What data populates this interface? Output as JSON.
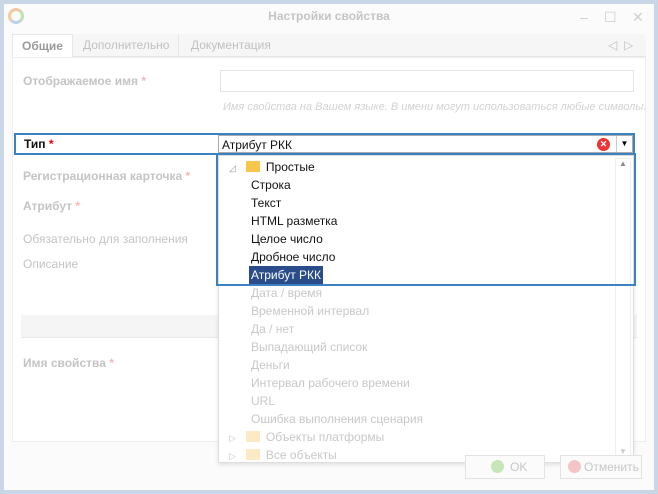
{
  "window": {
    "title": "Настройки свойства",
    "minimize": "–",
    "maximize": "☐",
    "close": "✕"
  },
  "tabs": [
    {
      "label": "Общие",
      "active": true
    },
    {
      "label": "Дополнительно"
    },
    {
      "label": "Документация"
    }
  ],
  "tab_nav": {
    "prev": "◁",
    "next": "▷"
  },
  "form": {
    "display_name_label": "Отображаемое имя",
    "display_name_value": "",
    "display_name_hint": "Имя свойства на Вашем языке. В имени могут использоваться любые символы.",
    "type_label": "Тип",
    "type_value": "Атрибут РКК",
    "reg_card_label": "Регистрационная карточка",
    "attribute_label": "Атрибут",
    "required_label": "Обязательно для заполнения",
    "description_label": "Описание",
    "property_name_label": "Имя свойства",
    "required_mark": "*"
  },
  "dropdown": {
    "group": "Простые",
    "group_toggle": "◿",
    "items": [
      "Строка",
      "Текст",
      "HTML разметка",
      "Целое число",
      "Дробное число",
      "Атрибут РКК",
      "Дата / время",
      "Временной интервал",
      "Да / нет",
      "Выпадающий список",
      "Деньги",
      "Интервал рабочего времени",
      "URL",
      "Ошибка выполнения сценария"
    ],
    "selected": "Атрибут РКК",
    "folders": [
      "Объекты платформы",
      "Все объекты"
    ],
    "folder_toggle": "▷"
  },
  "footer": {
    "ok": "OK",
    "cancel": "Отменить"
  },
  "colors": {
    "highlight": "#3c82c2",
    "selected": "#2a4d8a"
  }
}
